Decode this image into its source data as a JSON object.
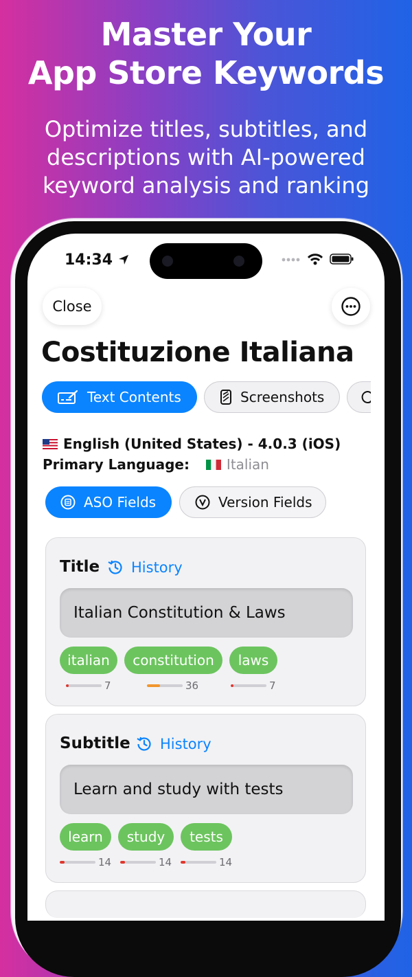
{
  "hero": {
    "title_line1": "Master Your",
    "title_line2": "App Store Keywords",
    "subtitle_line1": "Optimize titles, subtitles, and",
    "subtitle_line2": "descriptions with AI-powered",
    "subtitle_line3": "keyword analysis and ranking"
  },
  "status_bar": {
    "time": "14:34"
  },
  "nav": {
    "close_label": "Close",
    "more_icon": "ellipsis-circle-icon"
  },
  "page_title": "Costituzione Italiana",
  "tabs": [
    {
      "label": "Text Contents",
      "icon": "text-edit-icon",
      "active": true
    },
    {
      "label": "Screenshots",
      "icon": "screenshot-icon",
      "active": false
    },
    {
      "label": "",
      "icon": "chat-bubble-icon",
      "active": false
    }
  ],
  "language": {
    "current": "English (United States) - 4.0.3 (iOS)",
    "primary_label": "Primary Language:",
    "primary_value": "Italian"
  },
  "segments": [
    {
      "label": "ASO Fields",
      "active": true
    },
    {
      "label": "Version Fields",
      "active": false
    }
  ],
  "colors": {
    "accent": "#0a84ff",
    "chip": "#6cc45e",
    "meter_red": "#e0362c",
    "meter_orange": "#f0962e"
  },
  "fields": {
    "title": {
      "label": "Title",
      "history_label": "History",
      "value": "Italian Constitution & Laws",
      "keywords": [
        {
          "word": "italian",
          "score": "7",
          "level": 0.07
        },
        {
          "word": "constitution",
          "score": "36",
          "level": 0.36
        },
        {
          "word": "laws",
          "score": "7",
          "level": 0.07
        }
      ]
    },
    "subtitle": {
      "label": "Subtitle",
      "history_label": "History",
      "value": "Learn and study with tests",
      "keywords": [
        {
          "word": "learn",
          "score": "14",
          "level": 0.14
        },
        {
          "word": "study",
          "score": "14",
          "level": 0.14
        },
        {
          "word": "tests",
          "score": "14",
          "level": 0.14
        }
      ]
    }
  }
}
